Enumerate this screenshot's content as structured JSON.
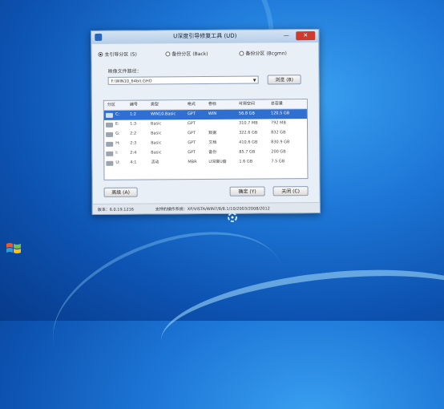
{
  "window": {
    "title": "U深度引导修复工具 (UD)",
    "min_label": "—",
    "close_label": "✕"
  },
  "mode": {
    "options": [
      {
        "label": "主引导分区 (S)",
        "selected": true
      },
      {
        "label": "备份分区 (Back)",
        "selected": false
      },
      {
        "label": "备份分区 (Bcgmn)",
        "selected": false
      }
    ]
  },
  "image_path": {
    "label": "映像文件路径：",
    "value": "F:\\WIN10_64bit.GHO",
    "browse_label": "浏览 (B)"
  },
  "table": {
    "columns": [
      "分区",
      "编号",
      "类型",
      "格式",
      "卷标",
      "可用空间",
      "总容量"
    ],
    "rows": [
      [
        "C:",
        "1:2",
        "WIN10.Basic",
        "GPT",
        "WIN",
        "56.8 GB",
        "120.5 GB"
      ],
      [
        "E:",
        "1:3",
        "Basic",
        "GPT",
        "",
        "310.7 MB",
        "792 MB"
      ],
      [
        "G:",
        "2:2",
        "Basic",
        "GPT",
        "数据",
        "322.6 GB",
        "832 GB"
      ],
      [
        "H:",
        "2:3",
        "Basic",
        "GPT",
        "文档",
        "410.6 GB",
        "830.9 GB"
      ],
      [
        "I:",
        "2:4",
        "Basic",
        "GPT",
        "备份",
        "85.7 GB",
        "200 GB"
      ],
      [
        "U:",
        "4:1",
        "活动",
        "MBR",
        "U深度U盘",
        "1.6 GB",
        "7.5 GB"
      ]
    ],
    "selected_row": 0
  },
  "buttons": {
    "advanced": "高级 (A)",
    "ok": "确定 (Y)",
    "close": "关闭 (C)"
  },
  "status": {
    "version": "版本：6.0.19.1216",
    "systems": "支持的操作系统：XP/VISTA/WIN7/8/8.1/10/2003/2008/2012"
  },
  "icons": {
    "app": "app-icon",
    "drive": "drive-icon",
    "dropdown": "chevron-down-icon",
    "desktop_logo": "windows-logo-icon",
    "cursor": "busy-cursor-icon"
  }
}
